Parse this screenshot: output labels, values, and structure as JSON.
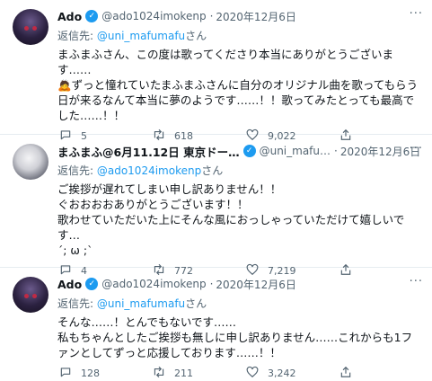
{
  "tweets": [
    {
      "name": "Ado",
      "handle": "@ado1024imokenp",
      "dot": "·",
      "date": "2020年12月6日",
      "more": "···",
      "reply_prefix": "返信先: ",
      "reply_to": "@uni_mafumafu",
      "reply_suffix": "さん",
      "text": "まふまふさん、この度は歌ってくださり本当にありがとうございます……\n🙇ずっと憧れていたまふまふさんに自分のオリジナル曲を歌ってもらう日が来るなんて本当に夢のようです……！！歌ってみたとっても最高でした……！！",
      "replies": "5",
      "retweets": "618",
      "likes": "9,022"
    },
    {
      "name": "まふまふ@6月11.12日 東京ドー…",
      "handle": "@uni_mafu…",
      "dot": "·",
      "date": "2020年12月6日",
      "more": "···",
      "reply_prefix": "返信先: ",
      "reply_to": "@ado1024imokenp",
      "reply_suffix": "さん",
      "text": "ご挨拶が遅れてしまい申し訳ありません！！\nぐおおおおありがとうございます！！\n歌わせていただいた上にそんな風におっしゃっていただけて嬉しいです…\n´; ω ;`",
      "replies": "4",
      "retweets": "772",
      "likes": "7,219"
    },
    {
      "name": "Ado",
      "handle": "@ado1024imokenp",
      "dot": "·",
      "date": "2020年12月6日",
      "more": "···",
      "reply_prefix": "返信先: ",
      "reply_to": "@uni_mafumafu",
      "reply_suffix": "さん",
      "text": "そんな……！とんでもないです……\n私もちゃんとしたご挨拶も無しに申し訳ありません……これからも1ファンとしてずっと応援しております……！！",
      "replies": "128",
      "retweets": "211",
      "likes": "3,242"
    }
  ],
  "icons": {
    "reply": "reply-icon",
    "retweet": "retweet-icon",
    "like": "heart-icon",
    "share": "share-icon",
    "verified": "verified-badge-icon"
  },
  "colors": {
    "accent": "#1d9bf0",
    "muted": "#536471"
  }
}
